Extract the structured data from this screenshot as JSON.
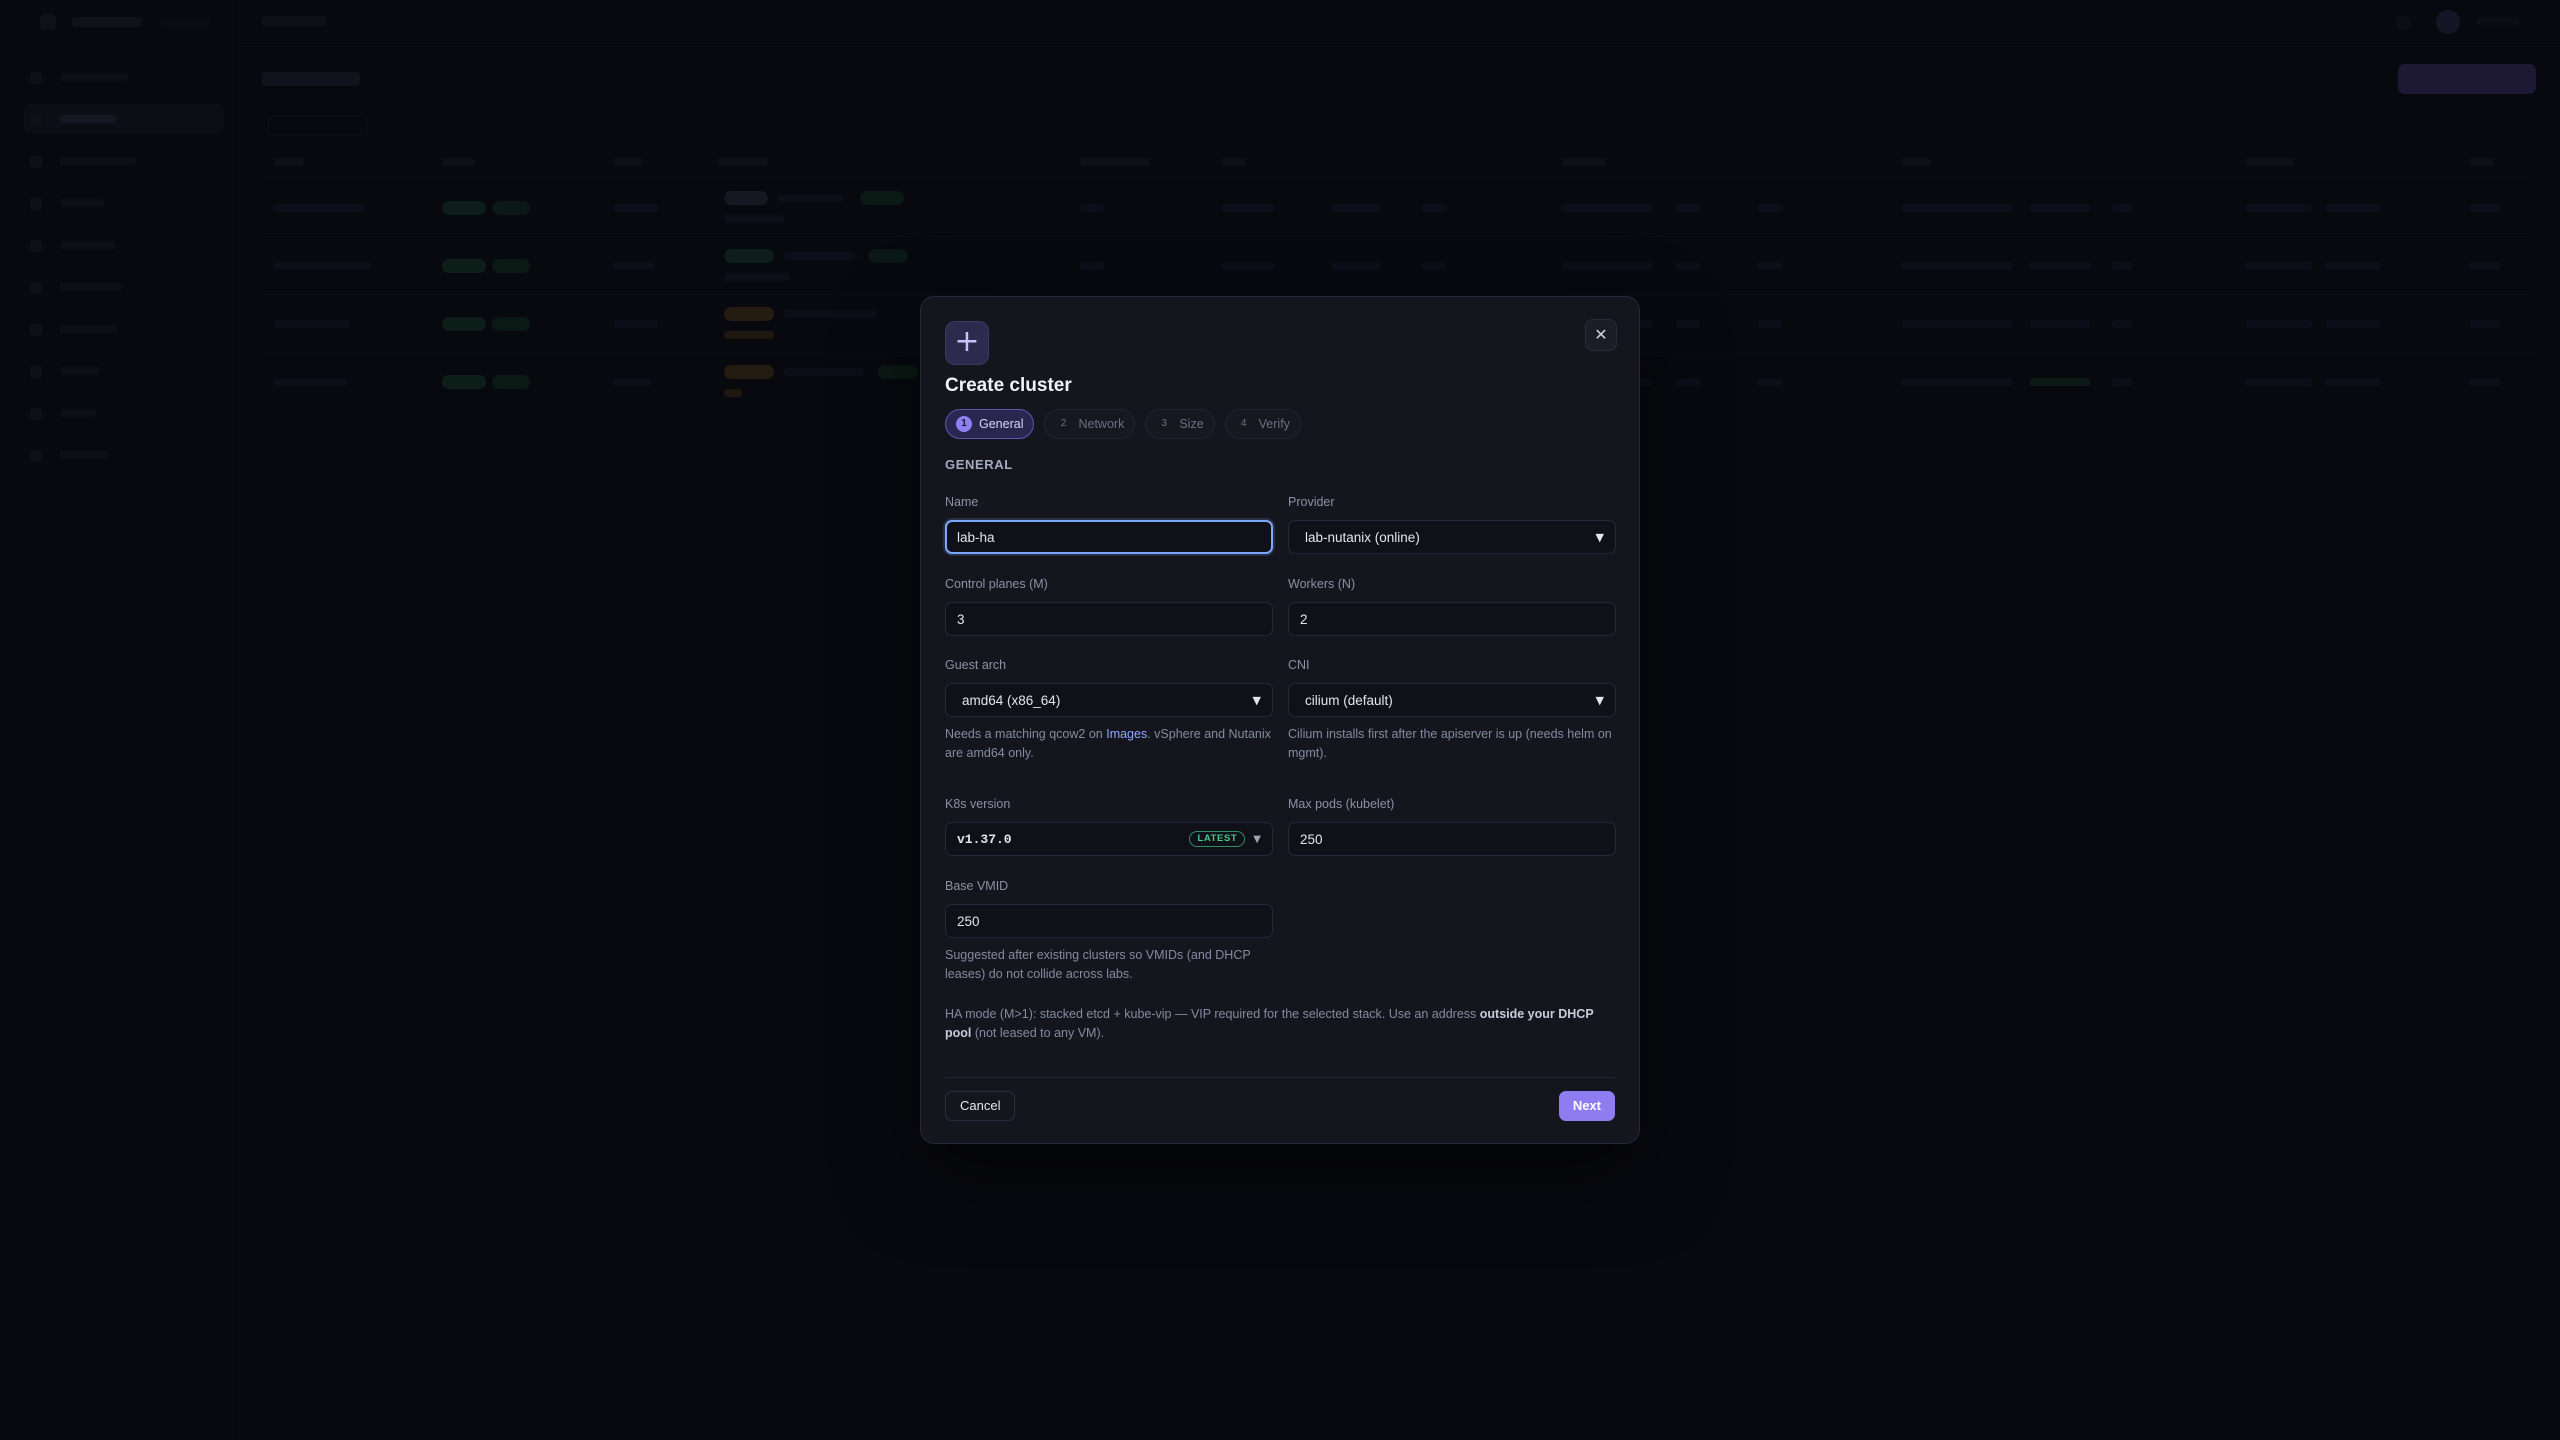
{
  "modal": {
    "title": "Create cluster",
    "plus_glyph": "+",
    "close_glyph": "✕",
    "steps": [
      {
        "num": "1",
        "label": "General"
      },
      {
        "num": "2",
        "label": "Network"
      },
      {
        "num": "3",
        "label": "Size"
      },
      {
        "num": "4",
        "label": "Verify"
      }
    ],
    "section": "GENERAL",
    "fields": {
      "name": {
        "label": "Name",
        "value": "lab-ha"
      },
      "provider": {
        "label": "Provider",
        "value": "lab-nutanix (online)"
      },
      "control_planes": {
        "label": "Control planes (M)",
        "value": "3"
      },
      "workers": {
        "label": "Workers (N)",
        "value": "2"
      },
      "guest_arch": {
        "label": "Guest arch",
        "value": "amd64 (x86_64)",
        "help_pre": "Needs a matching qcow2 on ",
        "help_link": "Images",
        "help_post": ". vSphere and Nutanix are amd64 only."
      },
      "cni": {
        "label": "CNI",
        "value": "cilium (default)",
        "help": "Cilium installs first after the apiserver is up (needs helm on mgmt)."
      },
      "k8s_version": {
        "label": "K8s version",
        "value": "v1.37.0",
        "badge": "LATEST"
      },
      "max_pods": {
        "label": "Max pods (kubelet)",
        "value": "250"
      },
      "base_vmid": {
        "label": "Base VMID",
        "value": "250",
        "help": "Suggested after existing clusters so VMIDs (and DHCP leases) do not collide across labs."
      }
    },
    "ha_note": {
      "pre": "HA mode (M>1): stacked etcd + kube-vip — VIP required for the selected stack. Use an address ",
      "bold": "outside your DHCP pool",
      "post": " (not leased to any VM)."
    },
    "buttons": {
      "cancel": "Cancel",
      "next": "Next"
    }
  },
  "colors": {
    "accent": "#8f7cf0",
    "focus": "#7aa8ff",
    "latest_badge": "#46c98d",
    "link": "#8fa8ff"
  },
  "icons": {
    "plus": "plus-icon",
    "close": "close-icon",
    "select_chevron": "chevron-down-icon"
  }
}
